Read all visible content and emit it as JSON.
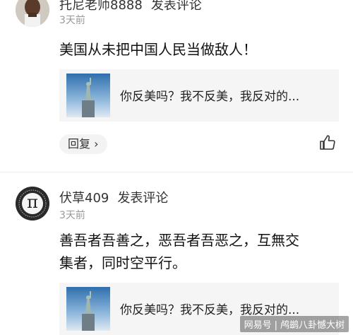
{
  "comments": [
    {
      "username": "托尼老师8888",
      "action": "发表评论",
      "time": "3天前",
      "text": "美国从未把中国人民当做敌人！",
      "quote_text": "你反美吗？我不反美，我反对的...",
      "reply_label": "回复",
      "reply_chevron": "›"
    },
    {
      "username": "伏草409",
      "action": "发表评论",
      "time": "3天前",
      "text_line1": "善吾者吾善之，恶吾者吾恶之，互無交",
      "text_line2": "集者，同时空平行。",
      "quote_text": "你反美吗？我不反美，我反对的...",
      "avatar_symbol": "π"
    }
  ],
  "watermark": {
    "brand": "网易号",
    "account": "鸬鹚八卦憾大树"
  },
  "icons": {
    "like": "thumbs-up-icon",
    "statue": "statue-of-liberty-thumbnail"
  }
}
